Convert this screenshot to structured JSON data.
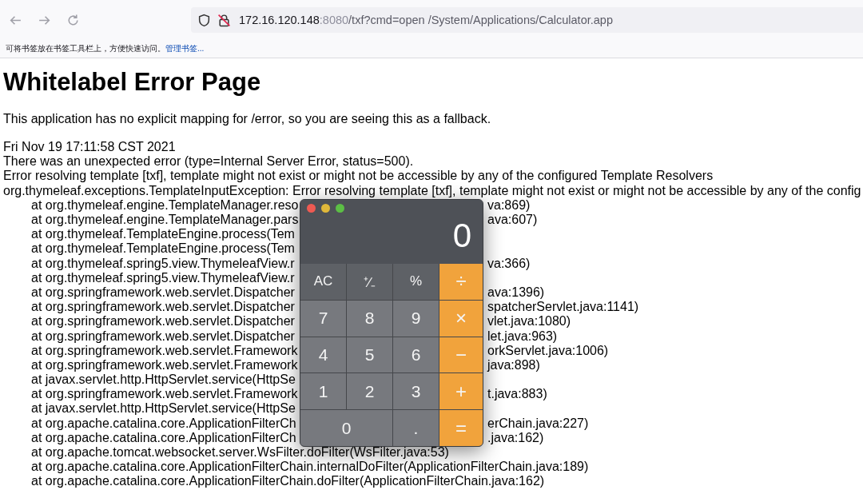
{
  "browser": {
    "url": {
      "host": "172.16.120.148",
      "port": ":8080",
      "path": "/txf?cmd=open /System/Applications/Calculator.app"
    },
    "bookmarks_bar": {
      "hint": "可将书签放在书签工具栏上，方便快速访问。",
      "link": "管理书签..."
    }
  },
  "page": {
    "title": "Whitelabel Error Page",
    "intro": "This application has no explicit mapping for /error, so you are seeing this as a fallback.",
    "lines": [
      "Fri Nov 19 17:11:58 CST 2021",
      "There was an unexpected error (type=Internal Server Error, status=500).",
      "Error resolving template [txf], template might not exist or might not be accessible by any of the configured Template Resolvers",
      "org.thymeleaf.exceptions.TemplateInputException: Error resolving template [txf], template might not exist or might not be accessible by any of the config"
    ],
    "trace": [
      {
        "left": "at org.thymeleaf.engine.TemplateManager.reso",
        "right": "va:869)"
      },
      {
        "left": "at org.thymeleaf.engine.TemplateManager.pars",
        "right": "ava:607)"
      },
      {
        "left": "at org.thymeleaf.TemplateEngine.process(Tem"
      },
      {
        "left": "at org.thymeleaf.TemplateEngine.process(Tem"
      },
      {
        "left": "at org.thymeleaf.spring5.view.ThymeleafView.r",
        "right": "va:366)"
      },
      {
        "left": "at org.thymeleaf.spring5.view.ThymeleafView.r"
      },
      {
        "left": "at org.springframework.web.servlet.Dispatcher",
        "right": "ava:1396)"
      },
      {
        "left": "at org.springframework.web.servlet.Dispatcher",
        "right": "spatcherServlet.java:1141)"
      },
      {
        "left": "at org.springframework.web.servlet.Dispatcher",
        "right": "vlet.java:1080)"
      },
      {
        "left": "at org.springframework.web.servlet.Dispatcher",
        "right": "let.java:963)"
      },
      {
        "left": "at org.springframework.web.servlet.Framework",
        "right": "orkServlet.java:1006)"
      },
      {
        "left": "at org.springframework.web.servlet.Framework",
        "right": "java:898)"
      },
      {
        "left": "at javax.servlet.http.HttpServlet.service(HttpSe"
      },
      {
        "left": "at org.springframework.web.servlet.Framework",
        "right": "t.java:883)"
      },
      {
        "left": "at javax.servlet.http.HttpServlet.service(HttpSe"
      },
      {
        "left": "at org.apache.catalina.core.ApplicationFilterCh",
        "right": "erChain.java:227)"
      },
      {
        "left": "at org.apache.catalina.core.ApplicationFilterCh",
        "right": ".java:162)"
      },
      {
        "left": "at org.apache.tomcat.websocket.server.WsFilter.doFilter(WsFilter.java:53)"
      },
      {
        "left": "at org.apache.catalina.core.ApplicationFilterChain.internalDoFilter(ApplicationFilterChain.java:189)"
      },
      {
        "left": "at org.apache.catalina.core.ApplicationFilterChain.doFilter(ApplicationFilterChain.java:162)"
      }
    ]
  },
  "calculator": {
    "display": "0",
    "keys": [
      {
        "label": "AC",
        "kind": "function"
      },
      {
        "label": "⁺∕₋",
        "kind": "function"
      },
      {
        "label": "%",
        "kind": "function"
      },
      {
        "label": "÷",
        "kind": "operator"
      },
      {
        "label": "7",
        "kind": "digit"
      },
      {
        "label": "8",
        "kind": "digit"
      },
      {
        "label": "9",
        "kind": "digit"
      },
      {
        "label": "×",
        "kind": "operator"
      },
      {
        "label": "4",
        "kind": "digit"
      },
      {
        "label": "5",
        "kind": "digit"
      },
      {
        "label": "6",
        "kind": "digit"
      },
      {
        "label": "−",
        "kind": "operator"
      },
      {
        "label": "1",
        "kind": "digit"
      },
      {
        "label": "2",
        "kind": "digit"
      },
      {
        "label": "3",
        "kind": "digit"
      },
      {
        "label": "+",
        "kind": "operator"
      },
      {
        "label": "0",
        "kind": "wide"
      },
      {
        "label": ".",
        "kind": "digit"
      },
      {
        "label": "=",
        "kind": "operator"
      }
    ]
  }
}
